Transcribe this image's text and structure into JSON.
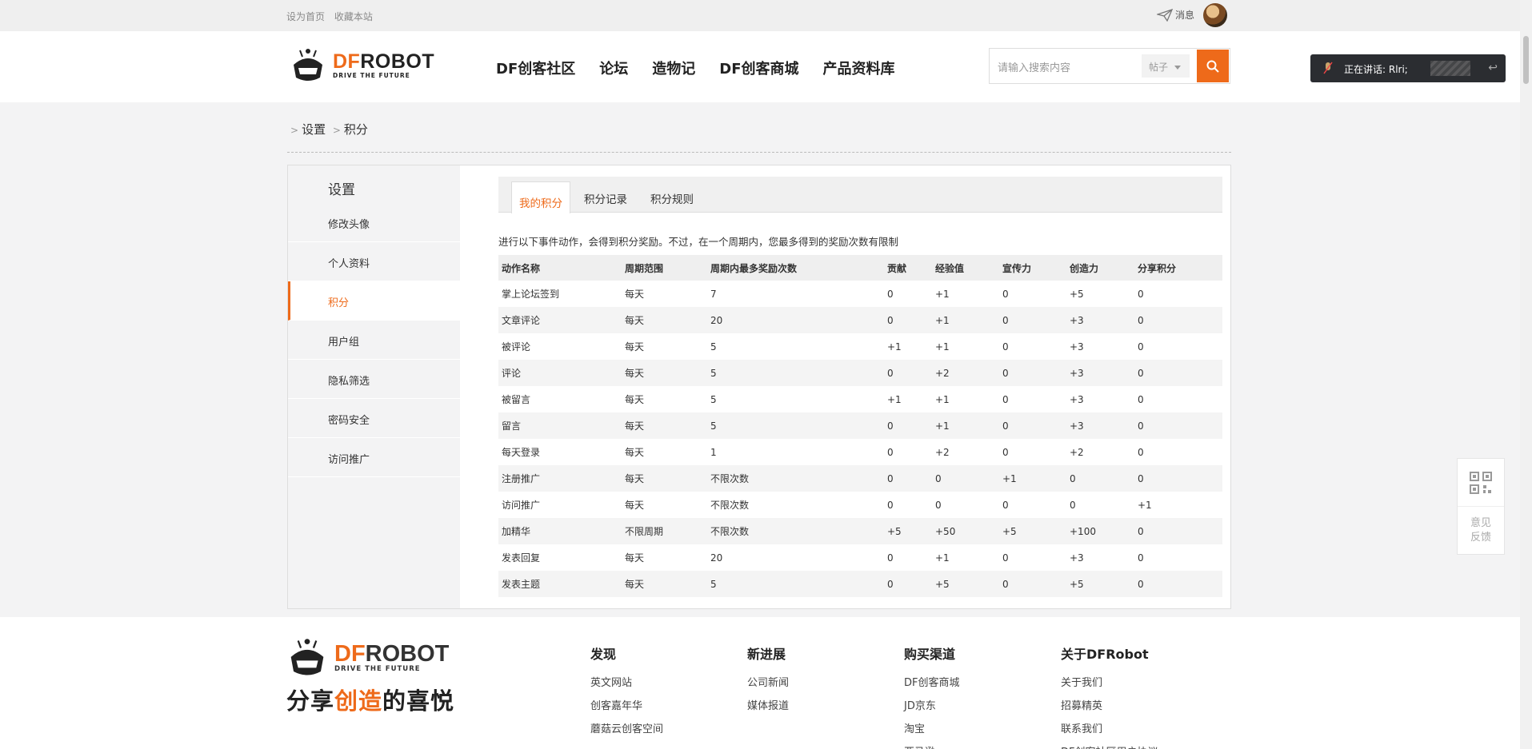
{
  "topbar": {
    "links": [
      "设为首页",
      "收藏本站"
    ],
    "message": "消息"
  },
  "logo": {
    "brand_df": "DF",
    "brand_rest": "ROBOT",
    "tagline": "DRIVE THE FUTURE"
  },
  "nav": [
    "DF创客社区",
    "论坛",
    "造物记",
    "DF创客商城",
    "产品资料库"
  ],
  "search": {
    "placeholder": "请输入搜索内容",
    "scope": "帖子"
  },
  "voice": {
    "label": "正在讲话: Rlri;"
  },
  "breadcrumb": [
    "设置",
    "积分"
  ],
  "sidebar": {
    "title": "设置",
    "items": [
      "修改头像",
      "个人资料",
      "积分",
      "用户组",
      "隐私筛选",
      "密码安全",
      "访问推广"
    ],
    "active_index": 2
  },
  "tabs": [
    "我的积分",
    "积分记录",
    "积分规则"
  ],
  "description": "进行以下事件动作，会得到积分奖励。不过，在一个周期内，您最多得到的奖励次数有限制",
  "table": {
    "headers": [
      "动作名称",
      "周期范围",
      "周期内最多奖励次数",
      "贡献",
      "经验值",
      "宣传力",
      "创造力",
      "分享积分"
    ],
    "rows": [
      [
        "掌上论坛签到",
        "每天",
        "7",
        "0",
        "+1",
        "0",
        "+5",
        "0"
      ],
      [
        "文章评论",
        "每天",
        "20",
        "0",
        "+1",
        "0",
        "+3",
        "0"
      ],
      [
        "被评论",
        "每天",
        "5",
        "+1",
        "+1",
        "0",
        "+3",
        "0"
      ],
      [
        "评论",
        "每天",
        "5",
        "0",
        "+2",
        "0",
        "+3",
        "0"
      ],
      [
        "被留言",
        "每天",
        "5",
        "+1",
        "+1",
        "0",
        "+3",
        "0"
      ],
      [
        "留言",
        "每天",
        "5",
        "0",
        "+1",
        "0",
        "+3",
        "0"
      ],
      [
        "每天登录",
        "每天",
        "1",
        "0",
        "+2",
        "0",
        "+2",
        "0"
      ],
      [
        "注册推广",
        "每天",
        "不限次数",
        "0",
        "0",
        "+1",
        "0",
        "0"
      ],
      [
        "访问推广",
        "每天",
        "不限次数",
        "0",
        "0",
        "0",
        "0",
        "+1"
      ],
      [
        "加精华",
        "不限周期",
        "不限次数",
        "+5",
        "+50",
        "+5",
        "+100",
        "0"
      ],
      [
        "发表回复",
        "每天",
        "20",
        "0",
        "+1",
        "0",
        "+3",
        "0"
      ],
      [
        "发表主题",
        "每天",
        "5",
        "0",
        "+5",
        "0",
        "+5",
        "0"
      ]
    ]
  },
  "float": {
    "feedback": "意见反馈"
  },
  "footer": {
    "slogan_a": "分享",
    "slogan_b": "创造",
    "slogan_c": "的喜悦",
    "columns": [
      {
        "title": "发现",
        "links": [
          "英文网站",
          "创客嘉年华",
          "蘑菇云创客空间"
        ]
      },
      {
        "title": "新进展",
        "links": [
          "公司新闻",
          "媒体报道"
        ]
      },
      {
        "title": "购买渠道",
        "links": [
          "DF创客商城",
          "JD京东",
          "淘宝",
          "亚马逊"
        ]
      },
      {
        "title": "关于DFRobot",
        "links": [
          "关于我们",
          "招募精英",
          "联系我们",
          "DF创客社区用户协议"
        ]
      }
    ]
  }
}
